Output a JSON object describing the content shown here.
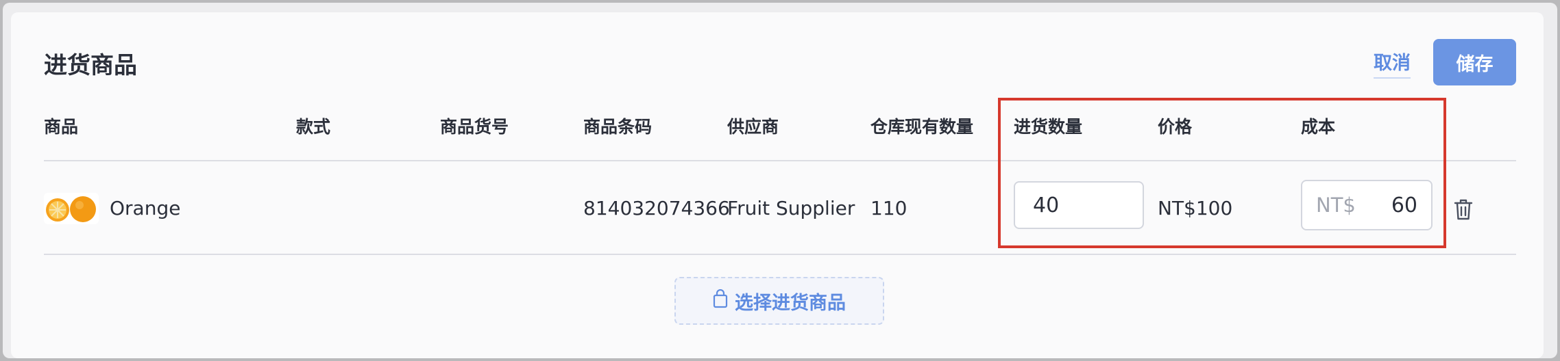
{
  "header": {
    "title": "进货商品",
    "cancel_label": "取消",
    "save_label": "储存"
  },
  "table": {
    "columns": [
      "商品",
      "款式",
      "商品货号",
      "商品条码",
      "供应商",
      "仓库现有数量",
      "进货数量",
      "价格",
      "成本"
    ],
    "rows": [
      {
        "product_name": "Orange",
        "style": "",
        "sku": "",
        "barcode": "814032074366",
        "supplier": "Fruit Supplier",
        "stock": "110",
        "purchase_qty": "40",
        "price": "NT$100",
        "cost_prefix": "NT$",
        "cost": "60"
      }
    ]
  },
  "select_products_label": "选择进货商品",
  "icons": {
    "product_thumb": "orange-image",
    "delete": "trash-icon",
    "bag": "shopping-bag-icon"
  },
  "colors": {
    "accent": "#6b95e3",
    "link": "#5e8be0",
    "highlight": "#d6392d"
  }
}
